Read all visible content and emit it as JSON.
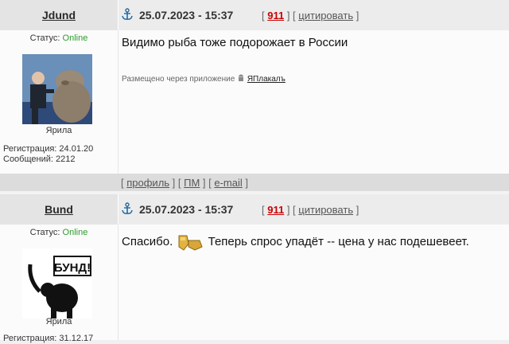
{
  "posts": [
    {
      "nick": "Jdund",
      "date": "25.07.2023 - 15:37",
      "post_number": "911",
      "quote_label": "цитировать",
      "status_label": "Статус: ",
      "status_value": "Online",
      "rank": "Ярила",
      "registration": "Регистрация: 24.01.20",
      "messages": "Сообщений: 2212",
      "text": "Видимо рыба тоже подорожает в России",
      "via_label": "Размещено через приложение",
      "via_app": "ЯПлакалъ",
      "footer": {
        "profile": "профиль",
        "pm": "ПМ",
        "email": "e-mail"
      }
    },
    {
      "nick": "Bund",
      "date": "25.07.2023 - 15:37",
      "post_number": "911",
      "quote_label": "цитировать",
      "status_label": "Статус: ",
      "status_value": "Online",
      "rank": "Ярила",
      "registration_partial": "Регистрация: 31.12.17",
      "text_before": "Спасибо.",
      "text_after": "Теперь спрос упадёт -- цена у нас подешевеет.",
      "avatar_caption": "БУНД!"
    }
  ]
}
